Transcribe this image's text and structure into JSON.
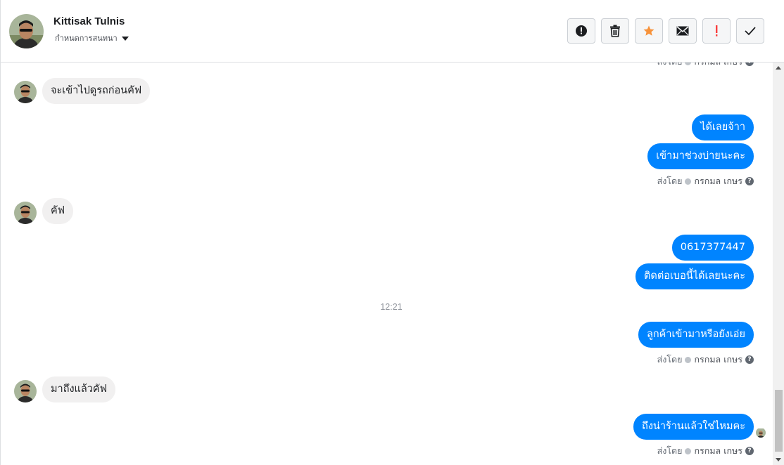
{
  "header": {
    "contact_name": "Kittisak Tulnis",
    "assign_label": "กำหนดการสนทนา",
    "toolbar": [
      {
        "name": "report-icon"
      },
      {
        "name": "trash-icon"
      },
      {
        "name": "star-icon",
        "color": "#f7923a"
      },
      {
        "name": "mail-icon"
      },
      {
        "name": "exclamation-icon",
        "color": "#fa3e3e"
      },
      {
        "name": "check-icon"
      }
    ]
  },
  "thread": {
    "top_sent_by": {
      "prefix": "ส่งโดย",
      "name": "กรกมล เกษร"
    },
    "messages": [
      {
        "side": "in",
        "text": "จะเข้าไปดูรถก่อนคัฟ"
      },
      {
        "side": "out",
        "text": "ได้เลยจ้าา"
      },
      {
        "side": "out",
        "text": "เข้ามาช่วงบ่ายนะคะ"
      },
      {
        "side": "in",
        "text": "คัฟ"
      },
      {
        "side": "out",
        "text": "0617377447"
      },
      {
        "side": "out",
        "text": "ติดต่อเบอนี้ได้เลยนะคะ"
      },
      {
        "side": "out",
        "text": "ลูกค้าเข้ามาหรือยังเอ่ย"
      },
      {
        "side": "in",
        "text": "มาถึงแล้วคัฟ"
      },
      {
        "side": "out",
        "text": "ถึงน่าร้านแล้วใช่ไหมคะ"
      }
    ],
    "sent_by": {
      "prefix": "ส่งโดย",
      "name": "กรกมล เกษร"
    },
    "timestamp": "12:21"
  },
  "colors": {
    "outgoing_bubble": "#0084ff",
    "incoming_bubble": "#f1f0f0"
  }
}
